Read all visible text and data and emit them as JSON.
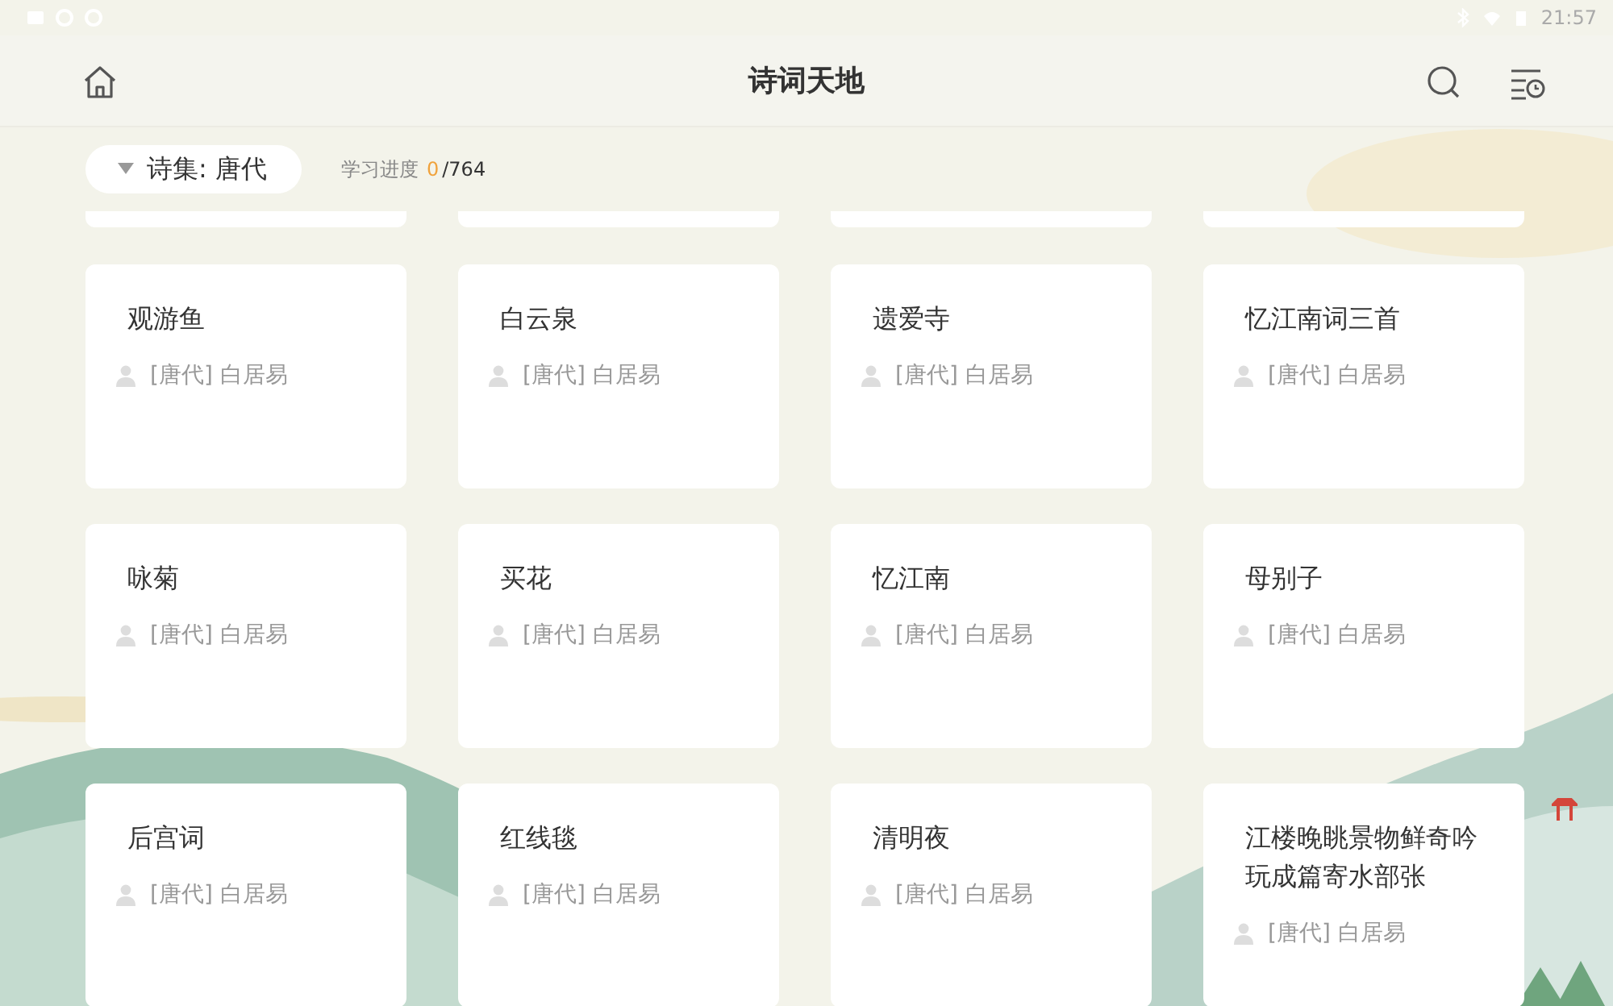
{
  "status_bar": {
    "time": "21:57"
  },
  "header": {
    "title": "诗词天地"
  },
  "filter": {
    "label": "诗集: 唐代",
    "progress_label": "学习进度",
    "progress_done": "0",
    "progress_total": "/764"
  },
  "cards": [
    {
      "kind": "cut"
    },
    {
      "kind": "cut"
    },
    {
      "kind": "cut"
    },
    {
      "kind": "cut"
    },
    {
      "kind": "poem",
      "title": "观游鱼",
      "author": "[唐代] 白居易"
    },
    {
      "kind": "poem",
      "title": "白云泉",
      "author": "[唐代] 白居易"
    },
    {
      "kind": "poem",
      "title": "遗爱寺",
      "author": "[唐代] 白居易"
    },
    {
      "kind": "poem",
      "title": "忆江南词三首",
      "author": "[唐代] 白居易"
    },
    {
      "kind": "poem",
      "title": "咏菊",
      "author": "[唐代] 白居易"
    },
    {
      "kind": "poem",
      "title": "买花",
      "author": "[唐代] 白居易"
    },
    {
      "kind": "poem",
      "title": "忆江南",
      "author": "[唐代] 白居易"
    },
    {
      "kind": "poem",
      "title": "母别子",
      "author": "[唐代] 白居易"
    },
    {
      "kind": "poem",
      "title": "后宫词",
      "author": "[唐代] 白居易"
    },
    {
      "kind": "poem",
      "title": "红线毯",
      "author": "[唐代] 白居易"
    },
    {
      "kind": "poem",
      "title": "清明夜",
      "author": "[唐代] 白居易"
    },
    {
      "kind": "poem",
      "title": "江楼晚眺景物鲜奇吟玩成篇寄水部张",
      "author": "[唐代] 白居易"
    }
  ]
}
